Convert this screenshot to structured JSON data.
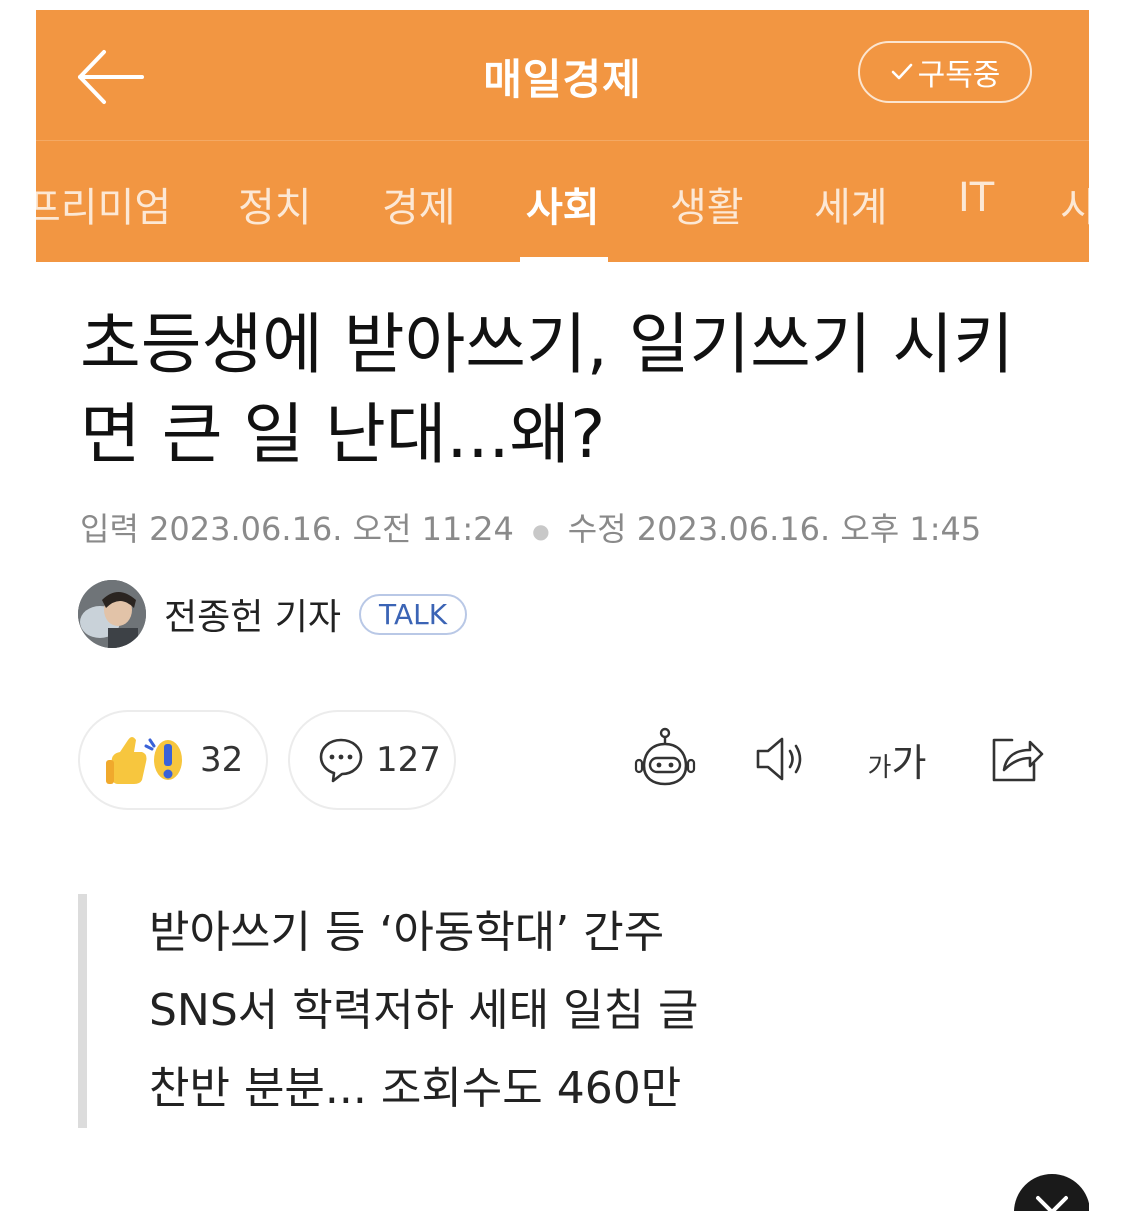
{
  "header": {
    "press_name": "매일경제",
    "subscribe_label": "구독중",
    "background_color": "#f29642"
  },
  "tabs": {
    "items": [
      {
        "label": "프리미엄"
      },
      {
        "label": "정치"
      },
      {
        "label": "경제"
      },
      {
        "label": "사회"
      },
      {
        "label": "생활"
      },
      {
        "label": "세계"
      },
      {
        "label": "IT"
      },
      {
        "label": "시"
      }
    ],
    "active": "사회"
  },
  "article": {
    "headline": "초등생에 받아쓰기, 일기쓰기 시키면 큰 일 난대...왜?",
    "input_label": "입력",
    "input_time": "2023.06.16. 오전 11:24",
    "modified_label": "수정",
    "modified_time": "2023.06.16. 오후 1:45"
  },
  "reporter": {
    "name": "전종헌 기자",
    "talk_label": "TALK"
  },
  "actions": {
    "reaction_count": "32",
    "comment_count": "127",
    "font_size_small": "가",
    "font_size_large": "가"
  },
  "summary": {
    "lines": [
      "받아쓰기 등 ‘아동학대’ 간주",
      "SNS서 학력저하 세태 일침 글",
      "찬반 분분... 조회수도 460만"
    ]
  },
  "icons": {
    "back": "arrow-left-icon",
    "check": "check-icon",
    "reaction": "thumbs-up-surprise-icon",
    "comment": "speech-bubble-icon",
    "summary_bot": "robot-icon",
    "tts": "speaker-icon",
    "share": "share-icon",
    "close": "close-icon"
  }
}
